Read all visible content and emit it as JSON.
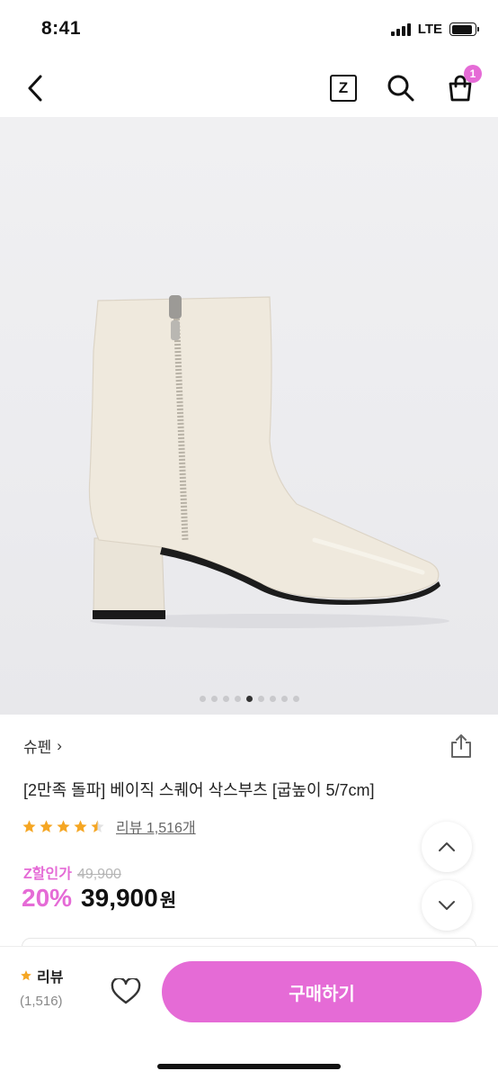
{
  "status_bar": {
    "time": "8:41",
    "network": "LTE",
    "battery_level": 0.9
  },
  "nav": {
    "back_icon": "chevron-left-icon",
    "zigzag_letter": "Z",
    "search_icon": "search-icon",
    "cart_icon": "shopping-bag-icon",
    "cart_count": "1"
  },
  "gallery": {
    "image_count": 9,
    "active_index": 4,
    "image_subject": "ivory square-toe ankle boot with side zipper and block heel"
  },
  "product": {
    "brand": "슈펜",
    "brand_chevron": "›",
    "title": "[2만족 돌파] 베이직 스퀘어 삭스부츠 [굽높이 5/7cm]",
    "rating": 4.5,
    "review_link": "리뷰 1,516개",
    "price_label": "Z할인가",
    "original_price": "49,900",
    "discount": "20%",
    "final_price": "39,900",
    "currency": "원"
  },
  "colors": {
    "accent": "#e56bd6",
    "star": "#f5a623"
  },
  "bottom_bar": {
    "review_label": "리뷰",
    "review_count": "(1,516)",
    "wishlist_icon": "heart-icon",
    "buy_label": "구매하기"
  }
}
